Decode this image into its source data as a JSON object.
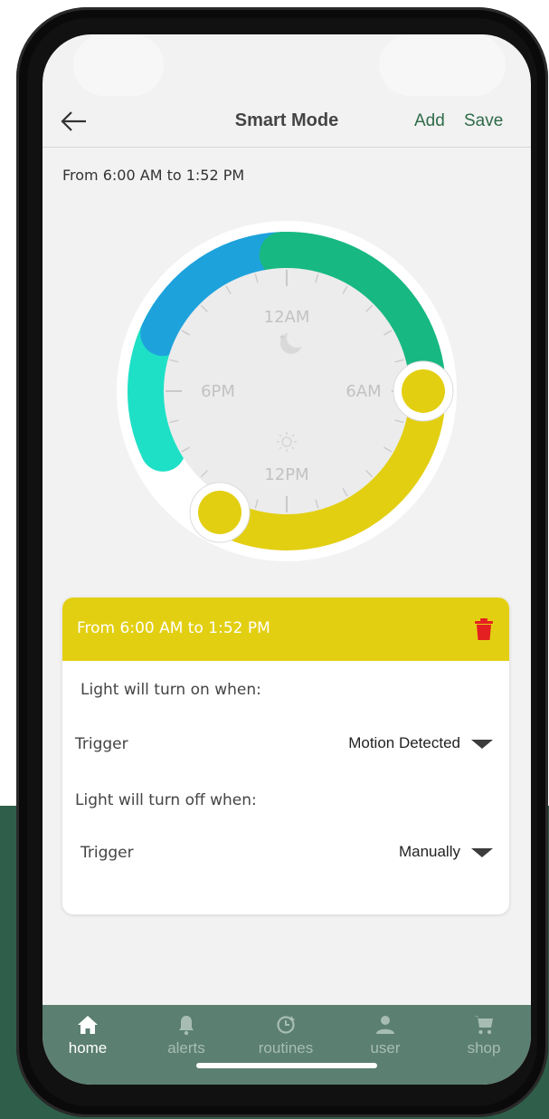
{
  "header": {
    "title": "Smart Mode",
    "add_label": "Add",
    "save_label": "Save"
  },
  "schedule": {
    "range_label": "From 6:00 AM to 1:52 PM"
  },
  "dial": {
    "hour_labels": {
      "top": "12AM",
      "right": "6AM",
      "bottom": "12PM",
      "left": "6PM"
    },
    "icons": [
      "moon-icon",
      "sun-icon"
    ],
    "colors": {
      "blue": "#1ea2dc",
      "green": "#17b882",
      "teal": "#1ee0c6",
      "yellow": "#e3cf12",
      "face": "#ececec",
      "ring_bg": "#ffffff"
    }
  },
  "card": {
    "title": "From 6:00 AM to 1:52 PM",
    "on_heading": "Light will turn on when:",
    "on_trigger_label": "Trigger",
    "on_trigger_value": "Motion Detected",
    "off_heading": "Light will turn off when:",
    "off_trigger_label": "Trigger",
    "off_trigger_value": "Manually",
    "accent": "#e3cf12",
    "delete_color": "#e52020"
  },
  "tabbar": {
    "tabs": [
      {
        "label": "home",
        "icon": "home-icon",
        "active": true
      },
      {
        "label": "alerts",
        "icon": "bell-icon",
        "active": false
      },
      {
        "label": "routines",
        "icon": "clock-refresh-icon",
        "active": false
      },
      {
        "label": "user",
        "icon": "user-icon",
        "active": false
      },
      {
        "label": "shop",
        "icon": "cart-icon",
        "active": false
      }
    ],
    "active_color": "#ffffff",
    "inactive_color": "#a7bdb4"
  }
}
